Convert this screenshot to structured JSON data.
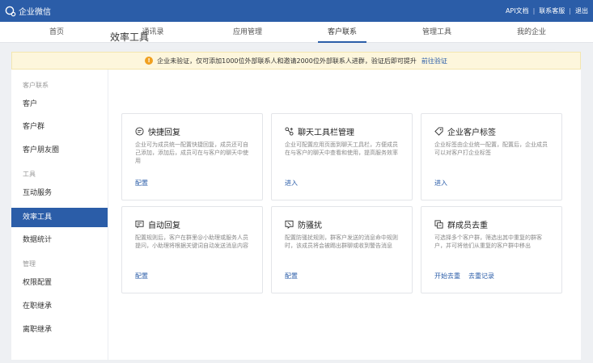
{
  "app": {
    "title": "企业微信"
  },
  "top_links": [
    "API文档",
    "联系客服",
    "退出"
  ],
  "nav": {
    "items": [
      {
        "label": "首页",
        "icon": "home"
      },
      {
        "label": "通讯录",
        "icon": "contacts"
      },
      {
        "label": "应用管理",
        "icon": "apps"
      },
      {
        "label": "客户联系",
        "icon": "customer",
        "active": true
      },
      {
        "label": "管理工具",
        "icon": "tools"
      },
      {
        "label": "我的企业",
        "icon": "company"
      }
    ]
  },
  "notice": {
    "text": "企业未验证，仅可添加1000位外部联系人和邀请2000位外部联系人进群，验证后即可提升",
    "link": "前往验证"
  },
  "sidebar": {
    "groups": [
      {
        "title": "客户联系",
        "items": [
          "客户",
          "客户群",
          "客户朋友圈"
        ]
      },
      {
        "title": "工具",
        "items": [
          "互动服务",
          "效率工具",
          "数据统计"
        ]
      },
      {
        "title": "管理",
        "items": [
          "权限配置",
          "在职继承",
          "离职继承"
        ]
      }
    ],
    "active": "效率工具"
  },
  "main": {
    "title": "效率工具",
    "cards": [
      {
        "title": "快捷回复",
        "icon": "quick-reply-icon",
        "desc": "企业可为成员统一配置快捷回复，成员还可自己添加，添加后，成员可在与客户的聊天中使用",
        "links": [
          "配置"
        ]
      },
      {
        "title": "聊天工具栏管理",
        "icon": "chat-toolbar-icon",
        "desc": "企业可配置应用页面到聊天工具栏，方便成员在与客户的聊天中查看和使用，提高服务效率",
        "links": [
          "进入"
        ]
      },
      {
        "title": "企业客户标签",
        "icon": "tag-icon",
        "desc": "企业标签由企业统一配置，配置后，企业成员可以对客户打企业标签",
        "links": [
          "进入"
        ]
      },
      {
        "title": "自动回复",
        "icon": "auto-reply-icon",
        "desc": "配置规则后，客户在群里@小助理或服务人员提问，小助理将根据关键词自动发送消息内容",
        "links": [
          "配置"
        ]
      },
      {
        "title": "防骚扰",
        "icon": "anti-harass-icon",
        "desc": "配置防骚扰规则，群客户发送的消息命中规则时，该成员将会被踢出群聊或收到警告消息",
        "links": [
          "配置"
        ]
      },
      {
        "title": "群成员去重",
        "icon": "dedup-icon",
        "desc": "可选择多个客户群，筛选出其中重复的群客户，并可将他们从重复的客户群中移出",
        "links": [
          "开始去重",
          "去重记录"
        ]
      }
    ]
  },
  "colors": {
    "brand": "#2b5da8",
    "notice_bg": "#fdf6dc",
    "warn": "#f0a020"
  }
}
